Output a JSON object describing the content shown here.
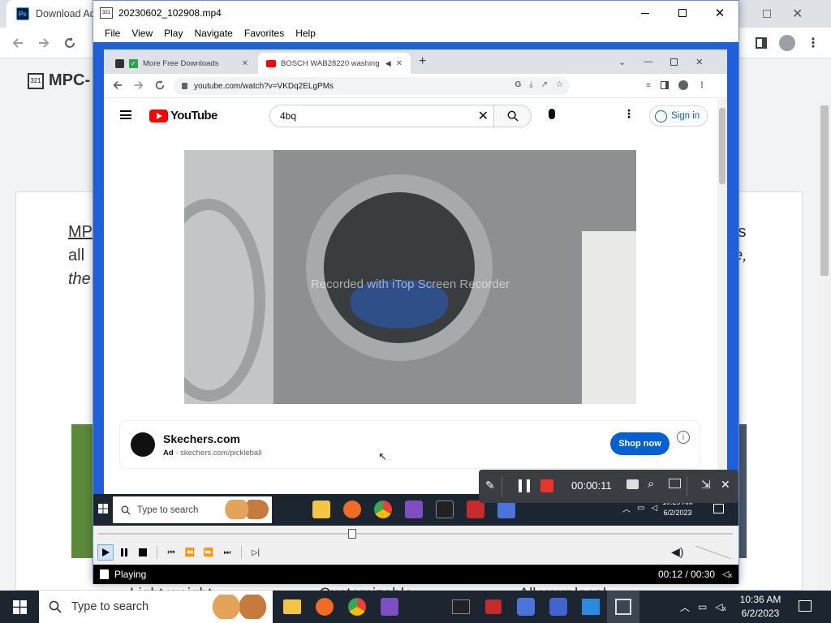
{
  "background_browser": {
    "tab_title": "Download Ad",
    "page_heading": "MPC-",
    "body_line1": "MP",
    "body_line1_right": "ts",
    "body_line2": "all",
    "body_line2_right": "e,",
    "body_line3": "the",
    "bottom_text": "Light weight                         Customizable                         All your local"
  },
  "mpc": {
    "title": "20230602_102908.mp4",
    "menu": [
      "File",
      "View",
      "Play",
      "Navigate",
      "Favorites",
      "Help"
    ],
    "status": "Playing",
    "time": "00:12 / 00:30",
    "seek_fraction": 0.4
  },
  "recorded_browser": {
    "tabs": [
      {
        "title": "More Free Downloads"
      },
      {
        "title": "BOSCH WAB28220 washing"
      }
    ],
    "new_tab": "+",
    "url": "youtube.com/watch?v=VKDq2ELgPMs",
    "youtube": {
      "logo_text": "YouTube",
      "search_value": "4bq",
      "sign_in": "Sign in",
      "watermark": "Recorded with iTop Screen Recorder",
      "ad": {
        "name": "Skechers.com",
        "ad_label": "Ad",
        "url": "skechers.com/pickleball",
        "button": "Shop now"
      }
    },
    "taskbar": {
      "search_placeholder": "Type to search",
      "time": "10:29 AM",
      "date": "6/2/2023"
    }
  },
  "recorder_toolbar": {
    "elapsed": "00:00:11"
  },
  "taskbar": {
    "search_placeholder": "Type to search",
    "time": "10:36 AM",
    "date": "6/2/2023"
  },
  "colors": {
    "mpc_background": "#1f5fd9",
    "youtube_red": "#ff0000",
    "link_blue": "#065fd4",
    "taskbar": "#1c2530",
    "record_red": "#e8352a"
  }
}
